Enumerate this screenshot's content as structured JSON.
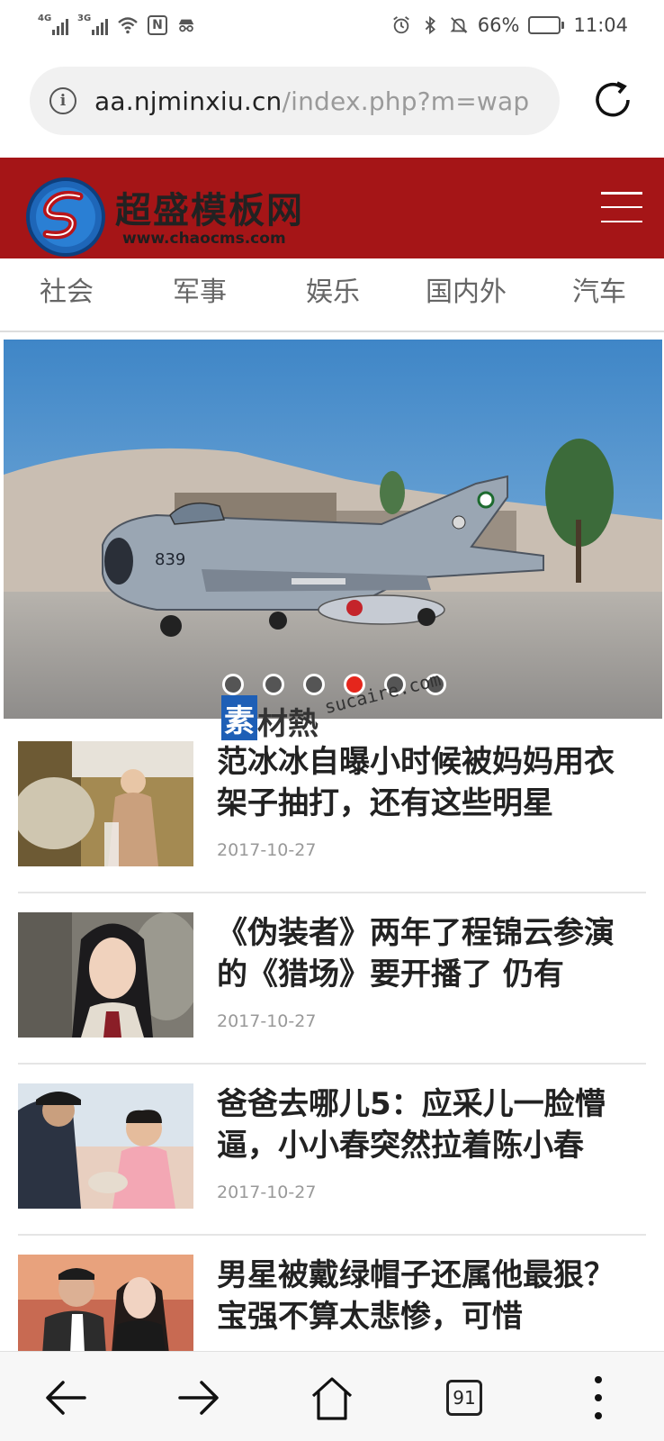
{
  "status_bar": {
    "signal1_label": "4G",
    "signal2_label": "3G",
    "nfc_label": "N",
    "battery_percent": "66%",
    "battery_level": 0.66,
    "time": "11:04",
    "icons": [
      "signal-icon",
      "wifi-icon",
      "nfc-icon",
      "incognito-icon",
      "alarm-icon",
      "bluetooth-icon",
      "mute-icon",
      "battery-icon"
    ]
  },
  "address_bar": {
    "url_host": "aa.njminxiu.cn",
    "url_path": "/index.php?m=wap",
    "info_icon": "i"
  },
  "site": {
    "logo_name": "超盛模板网",
    "logo_url": "www.chaocms.com",
    "header_color": "#a51517"
  },
  "categories": [
    "社会",
    "军事",
    "娱乐",
    "国内外",
    "汽车"
  ],
  "banner": {
    "aircraft_number": "839",
    "slide_count": 6,
    "active_slide": 4
  },
  "watermark": {
    "char_box": "素",
    "chars": "材熱",
    "domain": "sucaire.com"
  },
  "news": [
    {
      "title": "范冰冰自曝小时候被妈妈用衣架子抽打，还有这些明星",
      "date": "2017-10-27"
    },
    {
      "title": "《伪装者》两年了程锦云参演的《猎场》要开播了 仍有",
      "date": "2017-10-27"
    },
    {
      "title": "爸爸去哪儿5：应采儿一脸懵逼，小小春突然拉着陈小春",
      "date": "2017-10-27"
    },
    {
      "title": "男星被戴绿帽子还属他最狠？宝强不算太悲惨，可惜",
      "date": ""
    }
  ],
  "bottom_bar": {
    "tab_count": "91"
  },
  "colors": {
    "accent": "#e5261c",
    "brand_red": "#a51517",
    "date_gray": "#999999"
  }
}
